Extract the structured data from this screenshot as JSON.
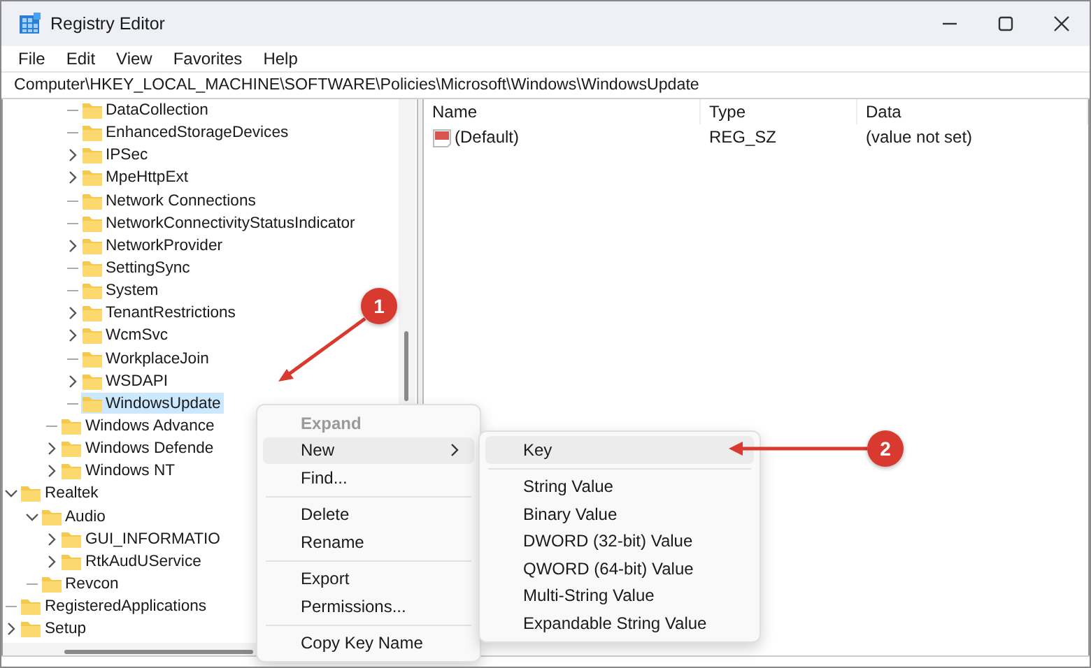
{
  "window": {
    "title": "Registry Editor"
  },
  "menu_bar": [
    "File",
    "Edit",
    "View",
    "Favorites",
    "Help"
  ],
  "address": "Computer\\HKEY_LOCAL_MACHINE\\SOFTWARE\\Policies\\Microsoft\\Windows\\WindowsUpdate",
  "tree": {
    "items": [
      {
        "children": [
          {
            "children": [
              {
                "children": [
                  {
                    "label": "DataCollection",
                    "selected": false
                  },
                  {
                    "label": "EnhancedStorageDevices",
                    "selected": false
                  },
                  {
                    "label": "IPSec",
                    "expanded": false,
                    "selected": false
                  },
                  {
                    "label": "MpeHttpExt",
                    "expanded": false,
                    "selected": false
                  },
                  {
                    "label": "Network Connections",
                    "selected": false
                  },
                  {
                    "label": "NetworkConnectivityStatusIndicator",
                    "selected": false
                  },
                  {
                    "label": "NetworkProvider",
                    "expanded": false,
                    "selected": false
                  },
                  {
                    "label": "SettingSync",
                    "selected": false
                  },
                  {
                    "label": "System",
                    "selected": false
                  },
                  {
                    "label": "TenantRestrictions",
                    "expanded": false,
                    "selected": false
                  },
                  {
                    "label": "WcmSvc",
                    "expanded": false,
                    "selected": false
                  },
                  {
                    "label": "WorkplaceJoin",
                    "selected": false
                  },
                  {
                    "label": "WSDAPI",
                    "expanded": false,
                    "selected": false
                  },
                  {
                    "label": "WindowsUpdate",
                    "selected": true
                  }
                ]
              },
              {
                "label": "Windows Advance",
                "selected": false
              },
              {
                "label": "Windows Defende",
                "expanded": false,
                "selected": false
              },
              {
                "label": "Windows NT",
                "expanded": false,
                "selected": false
              }
            ]
          }
        ]
      },
      {
        "label": "Realtek",
        "expanded": true,
        "selected": false,
        "children": [
          {
            "label": "Audio",
            "expanded": true,
            "selected": false,
            "children": [
              {
                "label": "GUI_INFORMATIO",
                "expanded": false,
                "selected": false
              },
              {
                "label": "RtkAudUService",
                "expanded": false,
                "selected": false
              }
            ]
          },
          {
            "label": "Revcon",
            "selected": false
          }
        ]
      },
      {
        "label": "RegisteredApplications",
        "selected": false
      },
      {
        "label": "Setup",
        "expanded": false,
        "selected": false
      }
    ]
  },
  "values": {
    "columns": [
      "Name",
      "Type",
      "Data"
    ],
    "rows": [
      {
        "name": "(Default)",
        "type": "REG_SZ",
        "data": "(value not set)"
      }
    ]
  },
  "context_menu": {
    "items": [
      {
        "kind": "item",
        "label": "Expand",
        "disabled": true,
        "selected": false,
        "has_submenu": false
      },
      {
        "kind": "item",
        "label": "New",
        "disabled": false,
        "selected": true,
        "has_submenu": true
      },
      {
        "kind": "item",
        "label": "Find...",
        "disabled": false,
        "selected": false,
        "has_submenu": false
      },
      {
        "kind": "separator"
      },
      {
        "kind": "item",
        "label": "Delete",
        "disabled": false,
        "selected": false,
        "has_submenu": false
      },
      {
        "kind": "item",
        "label": "Rename",
        "disabled": false,
        "selected": false,
        "has_submenu": false
      },
      {
        "kind": "separator"
      },
      {
        "kind": "item",
        "label": "Export",
        "disabled": false,
        "selected": false,
        "has_submenu": false
      },
      {
        "kind": "item",
        "label": "Permissions...",
        "disabled": false,
        "selected": false,
        "has_submenu": false
      },
      {
        "kind": "separator"
      },
      {
        "kind": "item",
        "label": "Copy Key Name",
        "disabled": false,
        "selected": false,
        "has_submenu": false
      }
    ]
  },
  "submenu": {
    "items": [
      {
        "kind": "item",
        "label": "Key",
        "disabled": false,
        "selected": true,
        "has_submenu": false
      },
      {
        "kind": "separator"
      },
      {
        "kind": "item",
        "label": "String Value",
        "disabled": false,
        "selected": false,
        "has_submenu": false
      },
      {
        "kind": "item",
        "label": "Binary Value",
        "disabled": false,
        "selected": false,
        "has_submenu": false
      },
      {
        "kind": "item",
        "label": "DWORD (32-bit) Value",
        "disabled": false,
        "selected": false,
        "has_submenu": false
      },
      {
        "kind": "item",
        "label": "QWORD (64-bit) Value",
        "disabled": false,
        "selected": false,
        "has_submenu": false
      },
      {
        "kind": "item",
        "label": "Multi-String Value",
        "disabled": false,
        "selected": false,
        "has_submenu": false
      },
      {
        "kind": "item",
        "label": "Expandable String Value",
        "disabled": false,
        "selected": false,
        "has_submenu": false
      }
    ]
  },
  "annotations": [
    {
      "number": "1"
    },
    {
      "number": "2"
    }
  ]
}
